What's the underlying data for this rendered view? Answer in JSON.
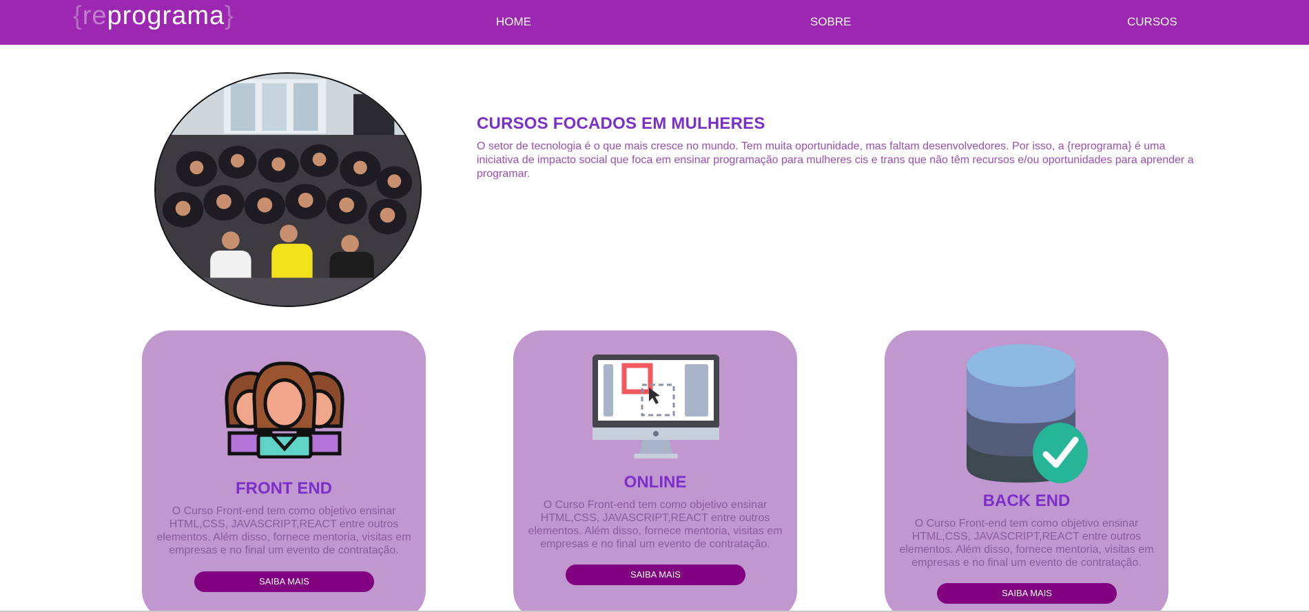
{
  "nav": {
    "logo": {
      "brace_open": "{",
      "re": "re",
      "programa": "programa",
      "brace_close": "}"
    },
    "links": [
      "HOME",
      "SOBRE",
      "CURSOS"
    ]
  },
  "hero": {
    "photo_alt": "group-photo",
    "title": "CURSOS FOCADOS EM MULHERES",
    "text": "O setor de tecnologia é o que mais cresce no mundo. Tem muita oportunidade, mas faltam desenvolvedores. Por isso, a {reprograma} é uma iniciativa de impacto social que foca em ensinar programação para mulheres cis e trans que não têm recursos e/ou oportunidades para aprender a programar."
  },
  "cards": [
    {
      "icon": "women-group-icon",
      "title": "FRONT END",
      "text": "O Curso Front-end tem como objetivo ensinar HTML,CSS, JAVASCRIPT,REACT entre outros elementos. Além disso, fornece mentoria, visitas em empresas e no final um evento de contratação.",
      "button": "SAIBA MAIS"
    },
    {
      "icon": "computer-monitor-icon",
      "title": "ONLINE",
      "text": "O Curso Front-end tem como objetivo ensinar HTML,CSS, JAVASCRIPT,REACT entre outros elementos. Além disso, fornece mentoria, visitas em empresas e no final um evento de contratação.",
      "button": "SAIBA MAIS"
    },
    {
      "icon": "database-check-icon",
      "title": "BACK END",
      "text": "O Curso Front-end tem como objetivo ensinar HTML,CSS, JAVASCRIPT,REACT entre outros elementos. Além disso, fornece mentoria, visitas em empresas e no final um evento de contratação.",
      "button": "SAIBA MAIS"
    }
  ],
  "colors": {
    "nav_bg": "#9c27b0",
    "card_bg": "#c197d0",
    "title": "#7b2fc9",
    "button": "#80007f"
  }
}
